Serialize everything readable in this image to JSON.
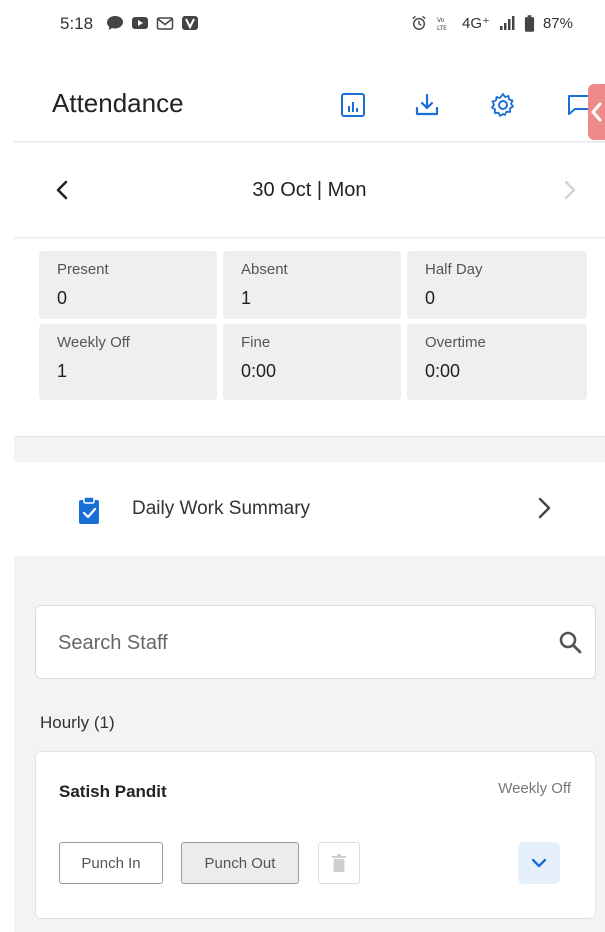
{
  "status_bar": {
    "time": "5:18",
    "network": "4G⁺",
    "battery": "87%",
    "icons": [
      "chat-bubble-icon",
      "youtube-icon",
      "gmail-icon",
      "v-app-icon",
      "alarm-icon",
      "volte-icon",
      "signal-icon",
      "battery-icon"
    ]
  },
  "header": {
    "title": "Attendance",
    "icons": [
      "report-icon",
      "download-icon",
      "settings-icon",
      "message-icon"
    ],
    "accent": "#1a6fd6"
  },
  "date_nav": {
    "label": "30 Oct | Mon",
    "prev_icon": "chevron-left-icon",
    "next_icon": "chevron-right-icon"
  },
  "stats": [
    {
      "label": "Present",
      "value": "0"
    },
    {
      "label": "Absent",
      "value": "1"
    },
    {
      "label": "Half Day",
      "value": "0"
    },
    {
      "label": "Weekly Off",
      "value": "1"
    },
    {
      "label": "Fine",
      "value": "0:00"
    },
    {
      "label": "Overtime",
      "value": "0:00"
    }
  ],
  "summary": {
    "label": "Daily Work Summary",
    "icon": "clipboard-check-icon"
  },
  "search": {
    "placeholder": "Search Staff",
    "value": ""
  },
  "groups": [
    {
      "title": "Hourly (1)",
      "staff": [
        {
          "name": "Satish Pandit",
          "status": "Weekly Off",
          "punch_in_label": "Punch In",
          "punch_out_label": "Punch Out"
        }
      ]
    }
  ]
}
